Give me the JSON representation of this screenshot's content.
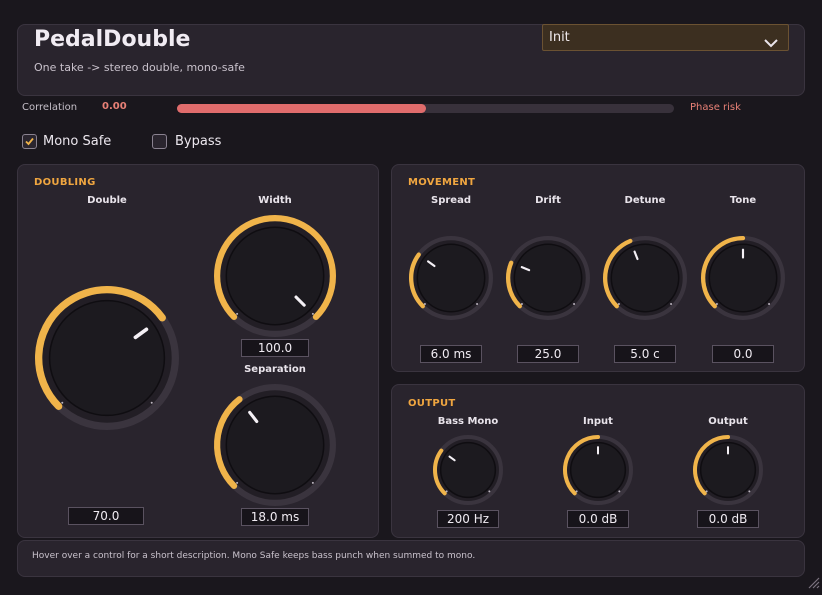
{
  "header": {
    "title": "PedalDouble",
    "subtitle": "One take -> stereo double, mono-safe",
    "preset": "Init"
  },
  "meter": {
    "label": "Correlation",
    "value": "0.00",
    "fill_fraction": 0.5,
    "risk_label": "Phase risk"
  },
  "toggles": {
    "mono_safe": {
      "label": "Mono Safe",
      "checked": true
    },
    "bypass": {
      "label": "Bypass",
      "checked": false
    }
  },
  "doubling": {
    "title": "DOUBLING",
    "knobs": {
      "double": {
        "label": "Double",
        "value": "70.0",
        "fraction": 0.7
      },
      "width": {
        "label": "Width",
        "value": "100.0",
        "fraction": 1.0
      },
      "separation": {
        "label": "Separation",
        "value": "18.0 ms",
        "fraction": 0.36
      }
    }
  },
  "movement": {
    "title": "MOVEMENT",
    "knobs": {
      "spread": {
        "label": "Spread",
        "value": "6.0 ms",
        "fraction": 0.3
      },
      "drift": {
        "label": "Drift",
        "value": "25.0",
        "fraction": 0.25
      },
      "detune": {
        "label": "Detune",
        "value": "5.0 c",
        "fraction": 0.42
      },
      "tone": {
        "label": "Tone",
        "value": "0.0",
        "fraction": 0.5
      }
    }
  },
  "output": {
    "title": "OUTPUT",
    "knobs": {
      "bass_mono": {
        "label": "Bass Mono",
        "value": "200 Hz",
        "fraction": 0.3
      },
      "input": {
        "label": "Input",
        "value": "0.0 dB",
        "fraction": 0.5
      },
      "output": {
        "label": "Output",
        "value": "0.0 dB",
        "fraction": 0.5
      }
    }
  },
  "status": {
    "text": "Hover over a control for a short description. Mono Safe keeps bass punch when summed to mono."
  },
  "colors": {
    "accent": "#f0b44a",
    "danger": "#e06c6c",
    "background": "#1a171d",
    "panel": "#29242d"
  }
}
